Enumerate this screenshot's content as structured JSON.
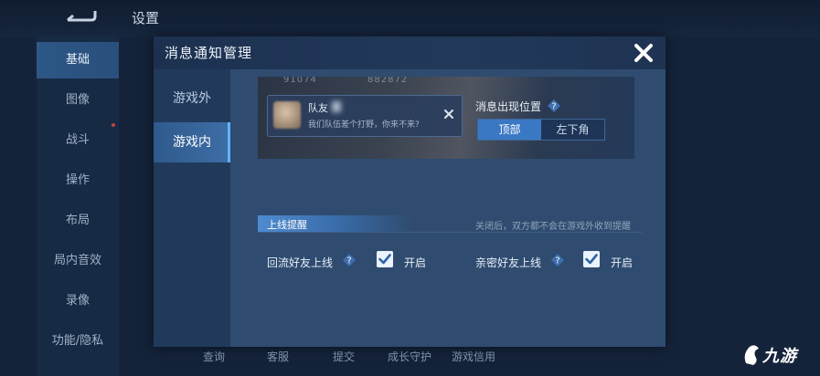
{
  "background": {
    "title": "设置",
    "side_items": [
      "基础",
      "图像",
      "战斗",
      "操作",
      "布局",
      "局内音效",
      "录像",
      "功能/隐私"
    ],
    "active_side_index": 0,
    "bottom_items": [
      "查询",
      "客服",
      "提交",
      "成长守护",
      "游戏信用"
    ]
  },
  "modal": {
    "title": "消息通知管理",
    "tabs": [
      "游戏外",
      "游戏内"
    ],
    "active_tab_index": 1,
    "preview": {
      "stat_a": "91074",
      "stat_b": "882872",
      "sender": "队友",
      "message": "我们队伍差个打野，你来不来?"
    },
    "position": {
      "label": "消息出现位置",
      "options": [
        "顶部",
        "左下角"
      ],
      "selected": "顶部"
    },
    "section": {
      "title": "上线提醒",
      "note": "关闭后，双方都不会在游戏外收到提醒"
    },
    "options": [
      {
        "label": "回流好友上线",
        "checked": true,
        "state_label": "开启"
      },
      {
        "label": "亲密好友上线",
        "checked": true,
        "state_label": "开启"
      }
    ]
  },
  "watermark": {
    "text": "九游",
    "icon": "jiuyou-logo-icon"
  },
  "colors": {
    "accent": "#3a78c4",
    "modal_bg": "#2e4b6e",
    "tab_active": "#3d6ea6"
  }
}
